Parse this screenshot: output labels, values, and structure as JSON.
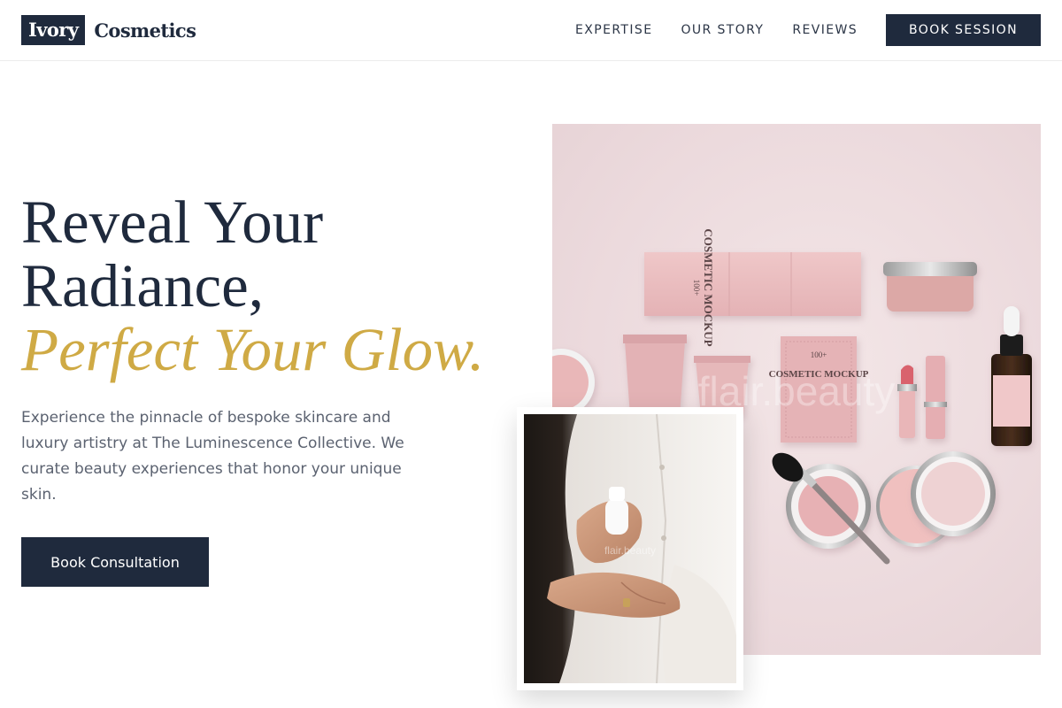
{
  "brand": {
    "box": "Ivory",
    "name": "Cosmetics",
    "primary": "#1f2a3d",
    "accent": "#cfaa45"
  },
  "nav": {
    "items": [
      "EXPERTISE",
      "OUR STORY",
      "REVIEWS"
    ],
    "cta": "BOOK SESSION"
  },
  "hero": {
    "title_line1": "Reveal Your",
    "title_line2": "Radiance,",
    "title_accent": "Perfect Your Glow.",
    "description": "Experience the pinnacle of bespoke skincare and luxury artistry at The Luminescence Collective. We curate beauty experiences that honor your unique skin.",
    "cta": "Book Consultation"
  },
  "images": {
    "main_watermark": "flair.beauty",
    "sub_watermark": "flair.beauty",
    "product_label": "COSMETIC MOCKUP",
    "product_number": "100+"
  }
}
